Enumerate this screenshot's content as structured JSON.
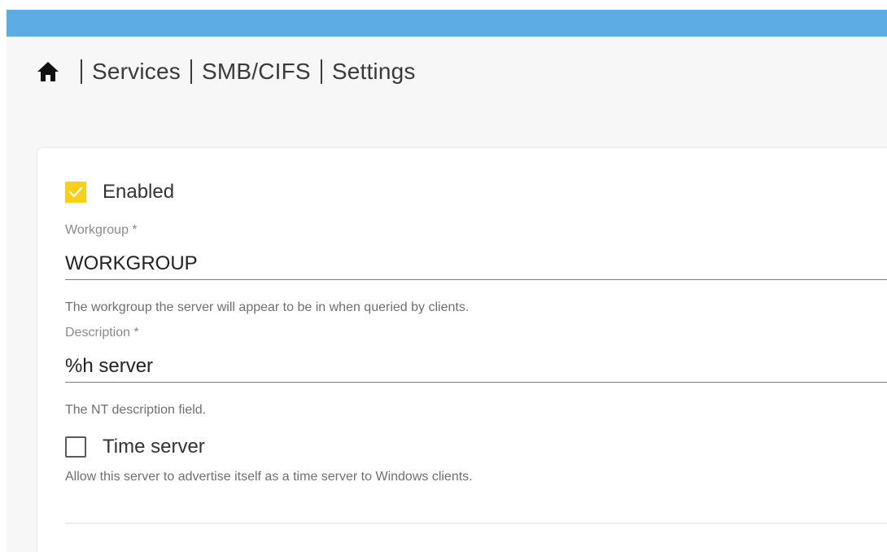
{
  "breadcrumb": {
    "home_icon": "home-icon",
    "items": [
      "Services",
      "SMB/CIFS",
      "Settings"
    ]
  },
  "form": {
    "enabled": {
      "label": "Enabled",
      "checked": true
    },
    "workgroup": {
      "label": "Workgroup *",
      "value": "WORKGROUP",
      "hint": "The workgroup the server will appear to be in when queried by clients."
    },
    "description": {
      "label": "Description *",
      "value": "%h server",
      "hint": "The NT description field."
    },
    "time_server": {
      "label": "Time server",
      "checked": false,
      "hint": "Allow this server to advertise itself as a time server to Windows clients."
    }
  },
  "colors": {
    "topbar": "#5dade2",
    "checkbox_checked": "#f9cf1a"
  }
}
